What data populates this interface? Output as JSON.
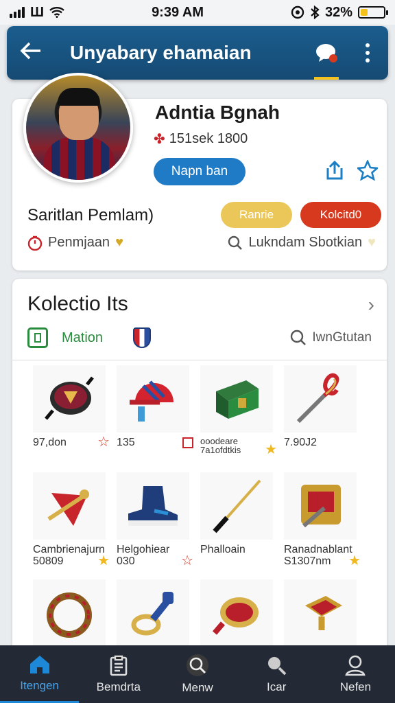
{
  "status_bar": {
    "carrier": "Ш",
    "time": "9:39 AM",
    "battery": "32%",
    "battery_level": 0.32
  },
  "app_bar": {
    "title": "Unyabary ehamaian"
  },
  "profile": {
    "name": "Adntia Bgnah",
    "stats": "151sek 1800",
    "follow_label": "Napn ban",
    "subtitle": "Saritlan Pemlam)",
    "pill_yellow": "Ranrie",
    "pill_red": "Kolcitd0",
    "info_left": "Penmjaan",
    "info_right": "Lukndam Sbotkian"
  },
  "collection": {
    "title": "Kolectio Its",
    "filter_label": "Mation",
    "search_label": "IwnGtutan",
    "items": [
      {
        "name": "",
        "value": "97,don",
        "badge": "star-outline-red"
      },
      {
        "name": "",
        "value": "135",
        "badge": "square-red"
      },
      {
        "name": "ooodeare",
        "value": "7a1ofdtkis",
        "badge": "star-filled"
      },
      {
        "name": "",
        "value": "7.90J2",
        "badge": ""
      },
      {
        "name": "Cambrienajurn",
        "value": "50809",
        "badge": "star-filled"
      },
      {
        "name": "Helgohiear",
        "value": "030",
        "badge": "star-outline-red"
      },
      {
        "name": "Phalloain",
        "value": "",
        "badge": ""
      },
      {
        "name": "Ranadnablant",
        "value": "S1307nm",
        "badge": "star-filled"
      },
      {
        "name": "",
        "value": "",
        "badge": ""
      },
      {
        "name": "",
        "value": "",
        "badge": ""
      },
      {
        "name": "",
        "value": "",
        "badge": ""
      },
      {
        "name": "",
        "value": "",
        "badge": ""
      }
    ]
  },
  "bottom_nav": [
    {
      "label": "Itengen",
      "icon": "home-icon"
    },
    {
      "label": "Bemdrta",
      "icon": "clipboard-icon"
    },
    {
      "label": "Menw",
      "icon": "search-circle-icon"
    },
    {
      "label": "Icar",
      "icon": "search-icon"
    },
    {
      "label": "Nefen",
      "icon": "profile-icon"
    }
  ]
}
